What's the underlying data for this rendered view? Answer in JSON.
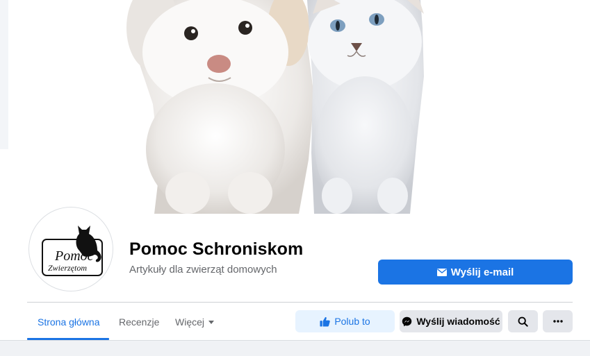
{
  "page": {
    "title": "Pomoc Schroniskom",
    "subtitle": "Artykuły dla zwierząt domowych"
  },
  "avatar": {
    "logo_line1": "Pomoc",
    "logo_line2": "Zwierzętom"
  },
  "buttons": {
    "email": "Wyślij e-mail",
    "like": "Polub to",
    "message": "Wyślij wiadomość"
  },
  "tabs": [
    {
      "label": "Strona główna",
      "active": true
    },
    {
      "label": "Recenzje",
      "active": false
    },
    {
      "label": "Więcej",
      "active": false
    }
  ],
  "icons": {
    "email": "envelope-icon",
    "like": "thumbs-up-icon",
    "message": "messenger-icon",
    "search": "search-icon",
    "more": "more-dots-icon",
    "dropdown": "caret-down-icon"
  },
  "colors": {
    "accent": "#1b74e4",
    "accent_light": "#e7f3ff",
    "secondary_button": "#e4e6eb",
    "muted_text": "#65676b"
  }
}
